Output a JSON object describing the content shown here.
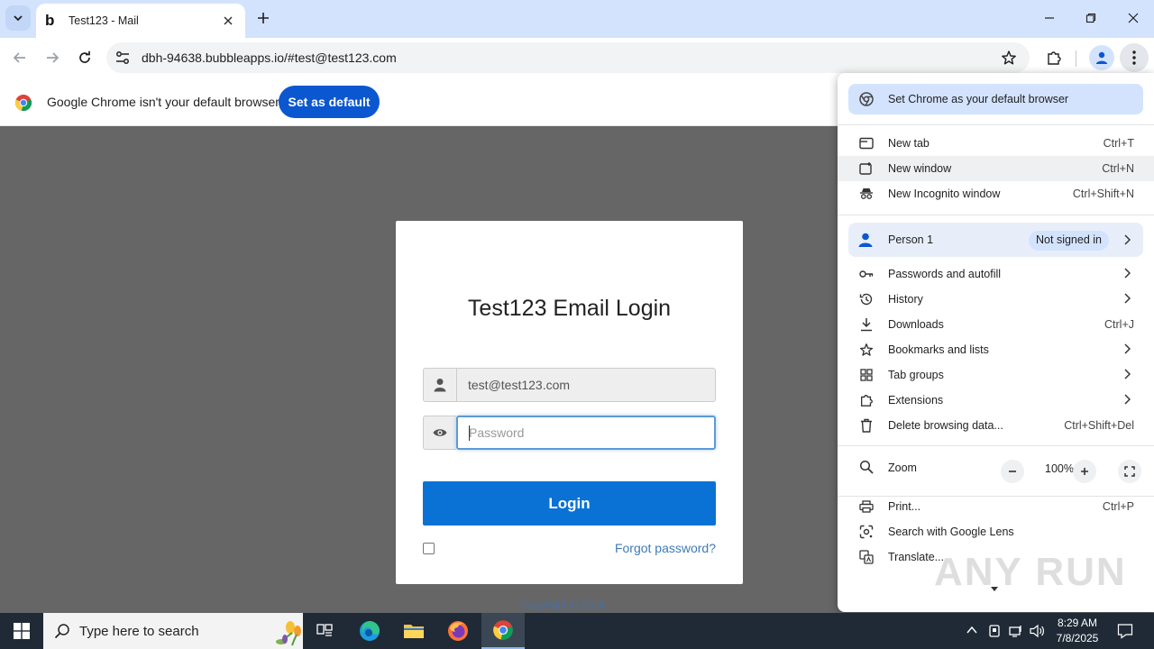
{
  "browser": {
    "tab_title": "Test123 - Mail",
    "tab_favicon": "b",
    "url": "dbh-94638.bubbleapps.io/#test@test123.com"
  },
  "infobar": {
    "message": "Google Chrome isn't your default browser",
    "button": "Set as default"
  },
  "login": {
    "title": "Test123 Email Login",
    "email_value": "test@test123.com",
    "password_placeholder": "Password",
    "login_button": "Login",
    "forgot_link": "Forgot password?",
    "copyright": "Copyright © 2024"
  },
  "menu": {
    "promo": "Set Chrome as your default browser",
    "new_tab": {
      "label": "New tab",
      "shortcut": "Ctrl+T"
    },
    "new_window": {
      "label": "New window",
      "shortcut": "Ctrl+N"
    },
    "incognito": {
      "label": "New Incognito window",
      "shortcut": "Ctrl+Shift+N"
    },
    "person": {
      "label": "Person 1",
      "status": "Not signed in"
    },
    "passwords": {
      "label": "Passwords and autofill"
    },
    "history": {
      "label": "History"
    },
    "downloads": {
      "label": "Downloads",
      "shortcut": "Ctrl+J"
    },
    "bookmarks": {
      "label": "Bookmarks and lists"
    },
    "tab_groups": {
      "label": "Tab groups"
    },
    "extensions": {
      "label": "Extensions"
    },
    "delete_data": {
      "label": "Delete browsing data...",
      "shortcut": "Ctrl+Shift+Del"
    },
    "zoom": {
      "label": "Zoom",
      "value": "100%"
    },
    "print": {
      "label": "Print...",
      "shortcut": "Ctrl+P"
    },
    "lens": {
      "label": "Search with Google Lens"
    },
    "translate": {
      "label": "Translate..."
    }
  },
  "watermark": "ANY RUN",
  "taskbar": {
    "search_placeholder": "Type here to search",
    "time": "8:29 AM",
    "date": "7/8/2025"
  },
  "colors": {
    "tabstrip": "#d3e3fd",
    "accent_blue": "#0b57d0",
    "login_button": "#0a72d4",
    "overlay": "#666666",
    "taskbar": "#1f2a36"
  }
}
